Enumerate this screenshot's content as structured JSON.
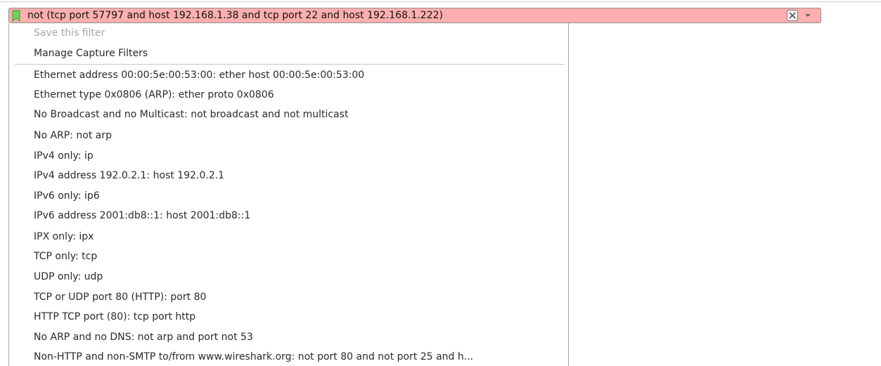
{
  "filter_bar": {
    "value": "not (tcp port 57797 and host 192.168.1.38 and tcp port 22 and host 192.168.1.222)",
    "background_color": "#ffafaf",
    "bookmark_icon": "bookmark-icon",
    "clear_icon": "clear-icon",
    "dropdown_icon": "chevron-down-icon"
  },
  "menu": {
    "save_filter_label": "Save this filter",
    "manage_filters_label": "Manage Capture Filters",
    "filters": [
      "Ethernet address 00:00:5e:00:53:00: ether host 00:00:5e:00:53:00",
      "Ethernet type 0x0806 (ARP): ether proto 0x0806",
      "No Broadcast and no Multicast: not broadcast and not multicast",
      "No ARP: not arp",
      "IPv4 only: ip",
      "IPv4 address 192.0.2.1: host 192.0.2.1",
      "IPv6 only: ip6",
      "IPv6 address 2001:db8::1: host 2001:db8::1",
      "IPX only: ipx",
      "TCP only: tcp",
      "UDP only: udp",
      "TCP or UDP port 80 (HTTP): port 80",
      "HTTP TCP port (80): tcp port http",
      "No ARP and no DNS: not arp and port not 53",
      "Non-HTTP and non-SMTP to/from www.wireshark.org: not port 80 and not port 25 and h..."
    ]
  }
}
